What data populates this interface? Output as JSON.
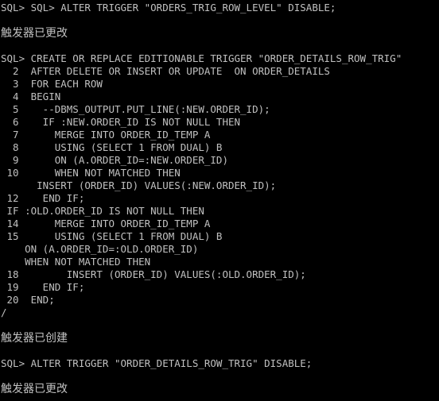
{
  "colors": {
    "background": "#000000",
    "text": "#c0c0c0"
  },
  "console": {
    "lines": [
      {
        "kind": "text",
        "text": "SQL> SQL> ALTER TRIGGER \"ORDERS_TRIG_ROW_LEVEL\" DISABLE;"
      },
      {
        "kind": "blank"
      },
      {
        "kind": "msg",
        "text": "触发器已更改"
      },
      {
        "kind": "blank"
      },
      {
        "kind": "text",
        "text": "SQL> CREATE OR REPLACE EDITIONABLE TRIGGER \"ORDER_DETAILS_ROW_TRIG\""
      },
      {
        "kind": "text",
        "text": "  2  AFTER DELETE OR INSERT OR UPDATE  ON ORDER_DETAILS"
      },
      {
        "kind": "text",
        "text": "  3  FOR EACH ROW"
      },
      {
        "kind": "text",
        "text": "  4  BEGIN"
      },
      {
        "kind": "text",
        "text": "  5    --DBMS_OUTPUT.PUT_LINE(:NEW.ORDER_ID);"
      },
      {
        "kind": "text",
        "text": "  6    IF :NEW.ORDER_ID IS NOT NULL THEN"
      },
      {
        "kind": "text",
        "text": "  7      MERGE INTO ORDER_ID_TEMP A"
      },
      {
        "kind": "text",
        "text": "  8      USING (SELECT 1 FROM DUAL) B"
      },
      {
        "kind": "text",
        "text": "  9      ON (A.ORDER_ID=:NEW.ORDER_ID)"
      },
      {
        "kind": "text",
        "text": " 10      WHEN NOT MATCHED THEN"
      },
      {
        "kind": "text",
        "text": "      INSERT (ORDER_ID) VALUES(:NEW.ORDER_ID);"
      },
      {
        "kind": "text",
        "text": " 12    END IF;"
      },
      {
        "kind": "text",
        "text": " IF :OLD.ORDER_ID IS NOT NULL THEN"
      },
      {
        "kind": "text",
        "text": " 14      MERGE INTO ORDER_ID_TEMP A"
      },
      {
        "kind": "text",
        "text": " 15      USING (SELECT 1 FROM DUAL) B"
      },
      {
        "kind": "text",
        "text": "    ON (A.ORDER_ID=:OLD.ORDER_ID)"
      },
      {
        "kind": "text",
        "text": "    WHEN NOT MATCHED THEN"
      },
      {
        "kind": "text",
        "text": " 18        INSERT (ORDER_ID) VALUES(:OLD.ORDER_ID);"
      },
      {
        "kind": "text",
        "text": " 19    END IF;"
      },
      {
        "kind": "text",
        "text": " 20  END;"
      },
      {
        "kind": "text",
        "text": "/"
      },
      {
        "kind": "blank"
      },
      {
        "kind": "msg",
        "text": "触发器已创建"
      },
      {
        "kind": "blank"
      },
      {
        "kind": "text",
        "text": "SQL> ALTER TRIGGER \"ORDER_DETAILS_ROW_TRIG\" DISABLE;"
      },
      {
        "kind": "blank"
      },
      {
        "kind": "msg",
        "text": "触发器已更改"
      }
    ]
  }
}
